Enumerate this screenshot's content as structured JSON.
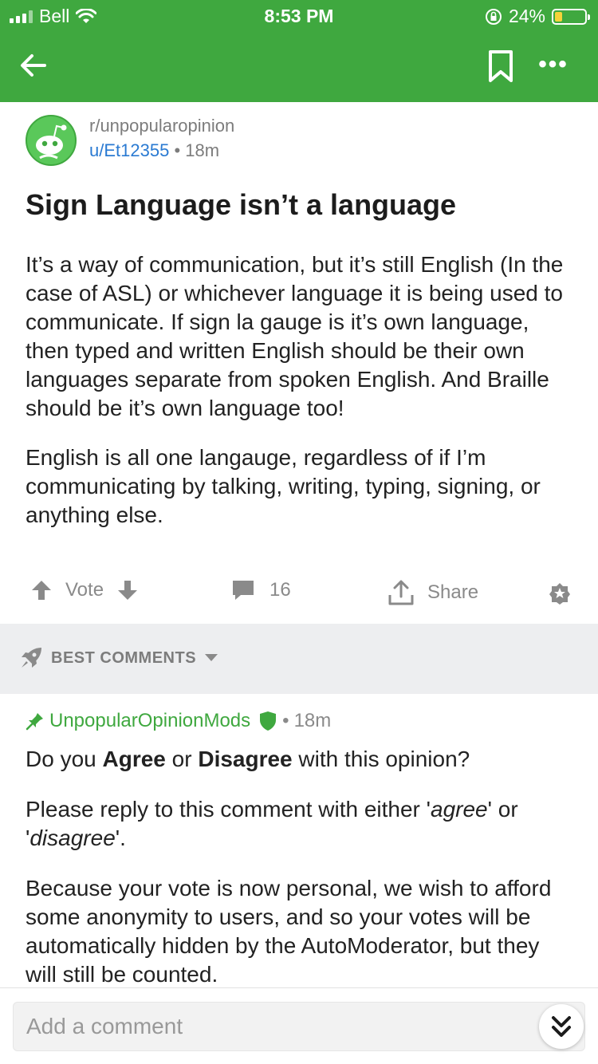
{
  "status_bar": {
    "carrier": "Bell",
    "time": "8:53 PM",
    "battery_percent": "24%",
    "battery_level": 0.24
  },
  "post": {
    "subreddit": "r/unpopularopinion",
    "author": "u/Et12355",
    "age": "18m",
    "title": "Sign Language isn’t a language",
    "paragraphs": [
      "It’s a way of communication, but it’s still English (In the case of ASL) or whichever language it is being used to communicate. If sign la gauge is it’s own language, then typed and written English should be their own languages separate from spoken English. And Braille should be it’s own language too!",
      "English is all one langauge, regardless of if I’m communicating by talking, writing, typing, signing, or anything else."
    ]
  },
  "actions": {
    "vote_label": "Vote",
    "comment_count": "16",
    "share_label": "Share"
  },
  "comments_header": {
    "sort_label": "BEST COMMENTS"
  },
  "comment": {
    "author": "UnpopularOpinionMods",
    "age": "18m",
    "p1_a": "Do you ",
    "p1_b": "Agree",
    "p1_c": " or ",
    "p1_d": "Disagree",
    "p1_e": " with this opinion?",
    "p2_a": "Please reply to this comment with either '",
    "p2_b": "agree",
    "p2_c": "' or '",
    "p2_d": "disagree",
    "p2_e": "'.",
    "p3": "Because your vote is now personal, we wish to afford some anonymity to users, and so your votes will be automatically hidden by the AutoModerator, but they will still be counted."
  },
  "composer": {
    "placeholder": "Add a comment"
  },
  "colors": {
    "brand_green": "#3fa83f",
    "link_blue": "#2a7ad2",
    "battery_yellow": "#f5d33a"
  }
}
